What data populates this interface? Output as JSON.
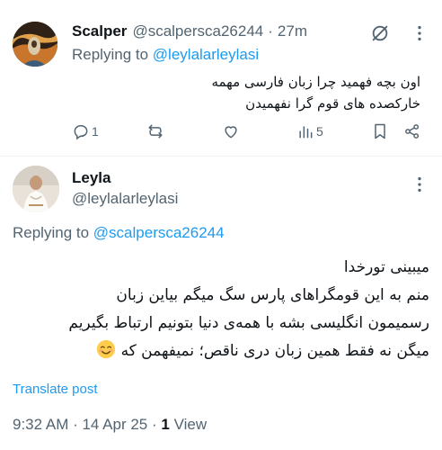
{
  "tweet1": {
    "name": "Scalper",
    "handle": "@scalpersca26244",
    "separator": "·",
    "time": "27m",
    "replying_prefix": "Replying to",
    "replying_handle": "@leylalarleylasi",
    "text_line1": "اون بچه فهمید چرا زبان فارسی مهمه",
    "text_line2": "خارکصده های قوم گرا نفهمیدن",
    "actions": {
      "reply_count": "1",
      "retweet_count": "",
      "like_count": "",
      "views_count": "5"
    },
    "icons": [
      "grok-icon",
      "more-icon",
      "reply-icon",
      "retweet-icon",
      "like-icon",
      "views-icon",
      "bookmark-icon",
      "share-icon"
    ]
  },
  "tweet2": {
    "name": "Leyla",
    "handle": "@leylalarleylasi",
    "replying_prefix": "Replying to",
    "replying_handle": "@scalpersca26244",
    "text_line1": "میبینی تورخدا",
    "text_line2": "منم به این قومگراهای پارس سگ میگم بیاین زبان",
    "text_line3": "رسمیمون انگلیسی بشه با همه‌ی دنیا بتونیم ارتباط بگیریم",
    "text_line4": "میگن نه فقط همین زبان دری ناقص؛ نمیفهمن که",
    "emoji": "smiling-face-emoji",
    "translate_label": "Translate post",
    "timestamp": "9:32 AM · 14 Apr 25 ·",
    "views_count": "1",
    "views_label": "View"
  },
  "colors": {
    "link": "#1d9bf0",
    "muted": "#536471",
    "text": "#0f1419",
    "divider": "#eff3f4"
  }
}
